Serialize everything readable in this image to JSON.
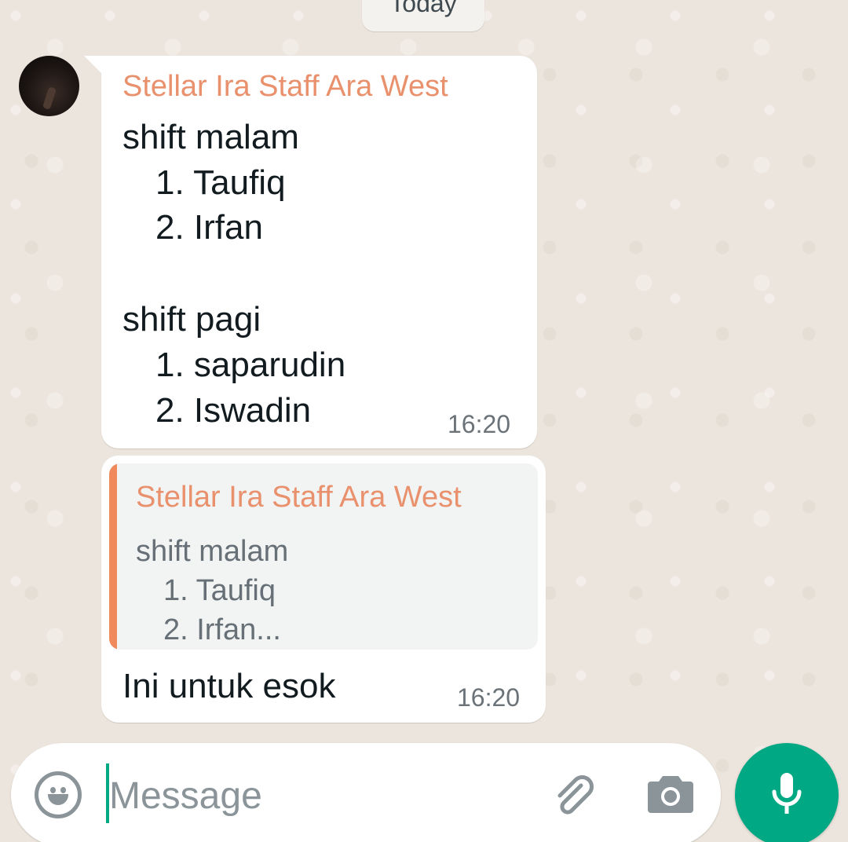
{
  "date_chip": "Today",
  "messages": [
    {
      "sender": "Stellar Ira Staff Ara West",
      "lines": [
        "shift malam",
        "1. Taufiq",
        "2. Irfan",
        "shift pagi",
        "1. saparudin",
        "2. Iswadin"
      ],
      "time": "16:20"
    },
    {
      "quote": {
        "sender": "Stellar Ira Staff Ara West",
        "lines": [
          "shift malam",
          "1. Taufiq",
          "2. Irfan..."
        ]
      },
      "text": "Ini untuk esok",
      "time": "16:20"
    }
  ],
  "composer": {
    "placeholder": "Message",
    "emoji_icon": "emoji-icon",
    "attach_icon": "paperclip-icon",
    "camera_icon": "camera-icon",
    "mic_icon": "microphone-icon"
  },
  "colors": {
    "sender_name": "#e9906c",
    "quote_bar": "#f08a5d",
    "accent": "#00a884",
    "chat_background": "#ece5dd"
  }
}
